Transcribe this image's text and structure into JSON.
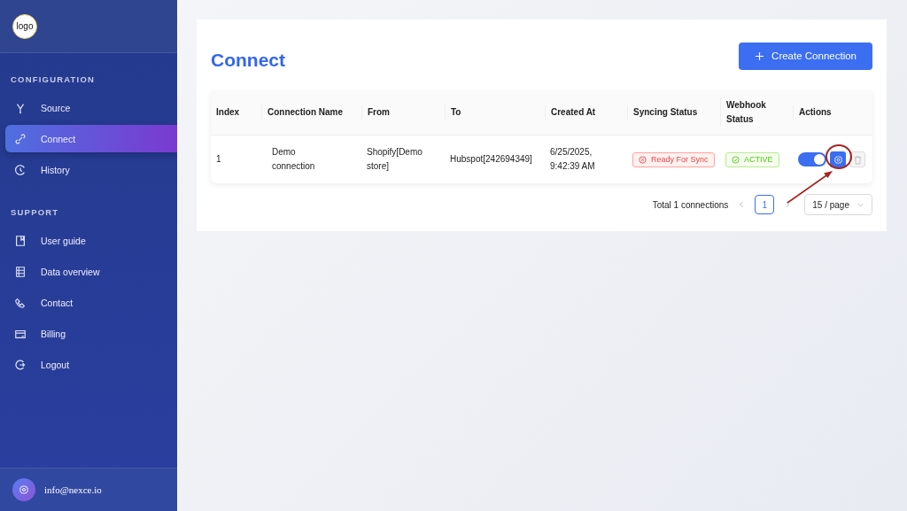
{
  "sidebar": {
    "logo": "logo",
    "sections": [
      {
        "title": "CONFIGURATION",
        "items": [
          {
            "label": "Source",
            "selected": false
          },
          {
            "label": "Connect",
            "selected": true
          },
          {
            "label": "History",
            "selected": false
          }
        ]
      },
      {
        "title": "SUPPORT",
        "items": [
          {
            "label": "User guide",
            "selected": false
          },
          {
            "label": "Data overview",
            "selected": false
          },
          {
            "label": "Contact",
            "selected": false
          },
          {
            "label": "Billing",
            "selected": false
          },
          {
            "label": "Logout",
            "selected": false
          }
        ]
      }
    ],
    "user": {
      "email": "info@nexce.io"
    }
  },
  "page": {
    "title": "Connect",
    "create_button": "Create Connection"
  },
  "table": {
    "columns": [
      "Index",
      "Connection Name",
      "From",
      "To",
      "Created At",
      "Syncing Status",
      "Webhook Status",
      "Actions"
    ],
    "rows": [
      {
        "index": "1",
        "name": "Demo connection",
        "from": "Shopify[Demo store]",
        "to": "Hubspot[242694349]",
        "created_at": "6/25/2025, 9:42:39 AM",
        "syncing_status": {
          "label": "Ready For Sync",
          "kind": "error"
        },
        "webhook_status": {
          "label": "ACTIVE",
          "kind": "success"
        },
        "enabled": true
      }
    ]
  },
  "pagination": {
    "total": "Total 1 connections",
    "pages": [
      {
        "label": "1",
        "selected": true
      }
    ],
    "page_size": "15 / page"
  }
}
